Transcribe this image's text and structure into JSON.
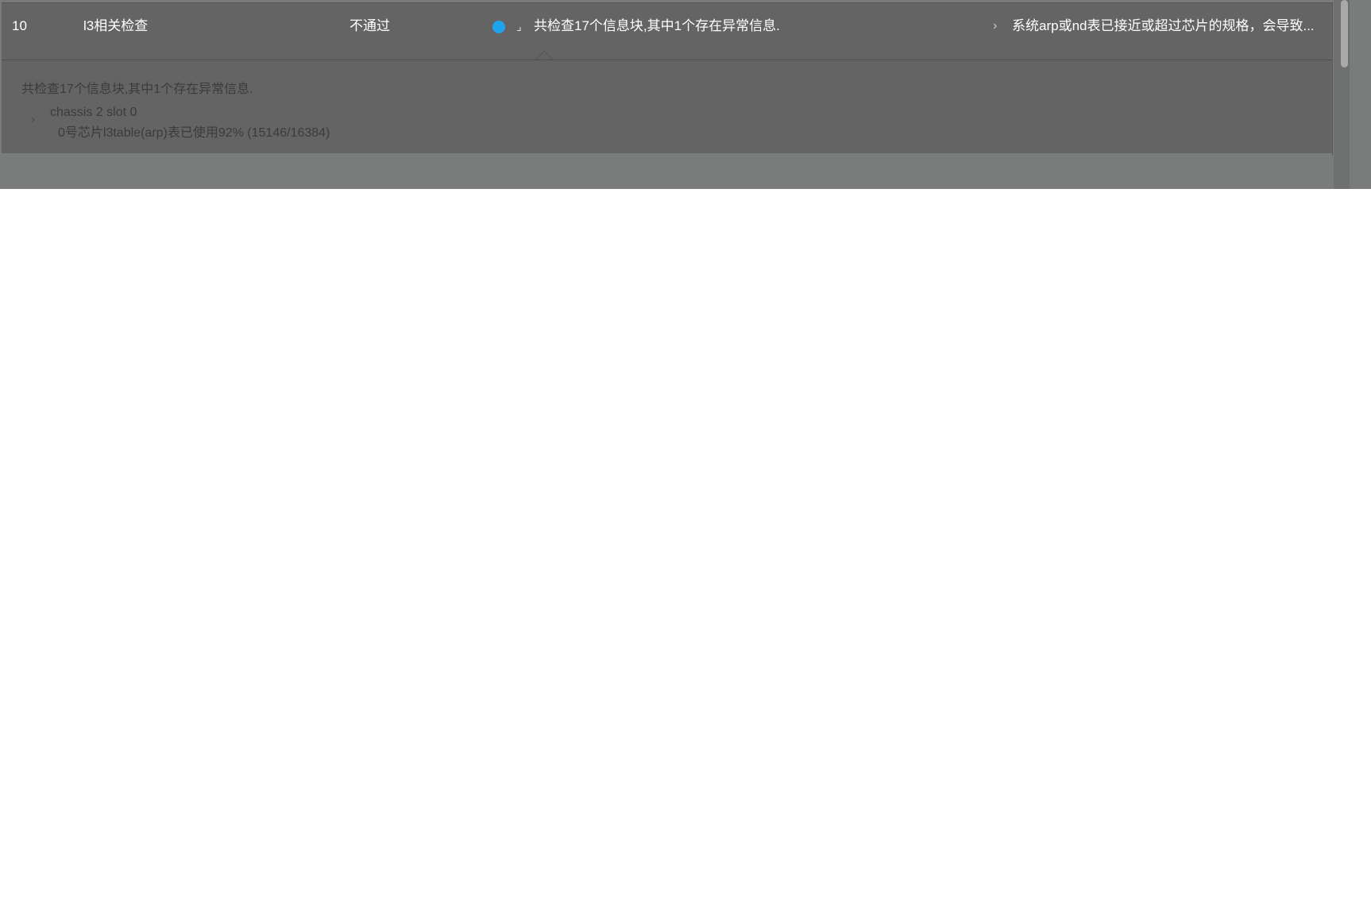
{
  "row": {
    "index": "10",
    "check_name": "l3相关检查",
    "result": "不通过",
    "status_color": "#1fa3ef",
    "expand_mark": "⌟",
    "summary": "共检查17个信息块,其中1个存在异常信息.",
    "suggestion": "系统arp或nd表已接近或超过芯片的规格，会导致..."
  },
  "detail": {
    "summary": "共检查17个信息块,其中1个存在异常信息.",
    "host": "chassis 2 slot 0",
    "message": "0号芯片l3table(arp)表已使用92% (15146/16384)"
  },
  "icons": {
    "status_dot": "status-dot-icon",
    "expand_mark": "collapse-corner-icon",
    "suggestion_chevron": "chevron-right-icon",
    "detail_chevron": "chevron-right-icon"
  }
}
